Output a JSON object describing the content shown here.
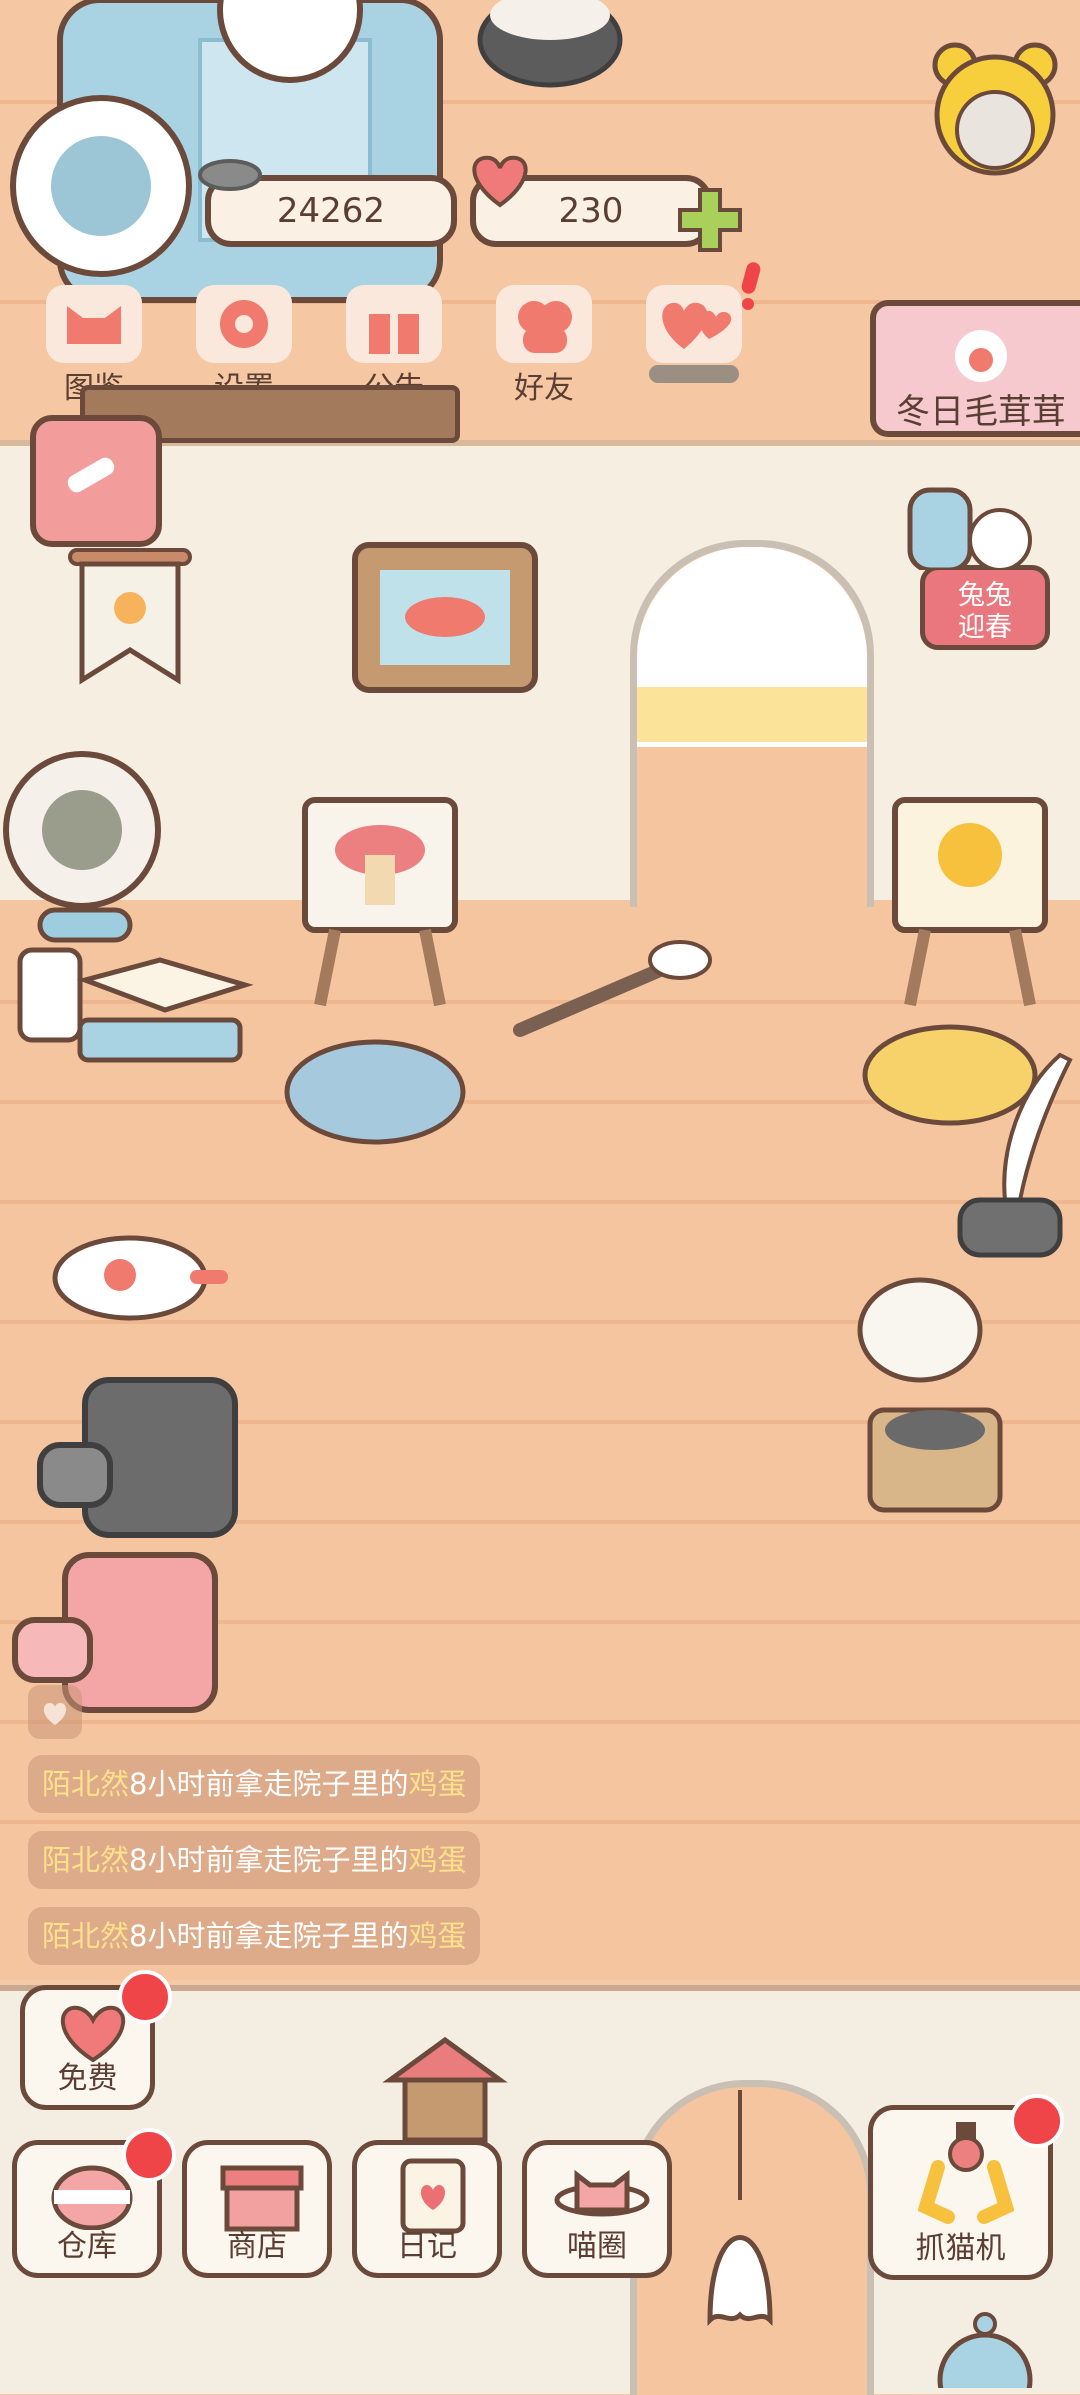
{
  "currency": {
    "fish": "24262",
    "hearts": "230"
  },
  "top_menu": [
    {
      "label": "图鉴",
      "icon": "cat-head-icon"
    },
    {
      "label": "设置",
      "icon": "gear-icon"
    },
    {
      "label": "公告",
      "icon": "gift-icon"
    },
    {
      "label": "好友",
      "icon": "friends-icon"
    },
    {
      "label": "",
      "icon": "hearts-icon"
    }
  ],
  "event_banner": "冬日毛茸茸",
  "spring_badge": [
    "兔兔",
    "迎春"
  ],
  "feed": [
    {
      "name": "陌北然",
      "text": "8小时前拿走院子里的",
      "item": "鸡蛋"
    },
    {
      "name": "陌北然",
      "text": "8小时前拿走院子里的",
      "item": "鸡蛋"
    },
    {
      "name": "陌北然",
      "text": "8小时前拿走院子里的",
      "item": "鸡蛋"
    }
  ],
  "bottom": {
    "free": "免费",
    "warehouse": "仓库",
    "shop": "商店",
    "diary": "日记",
    "circle": "喵圈",
    "claw": "抓猫机"
  },
  "colors": {
    "accent_red": "#f04548",
    "outline": "#6b4a3b",
    "floor": "#f5c5a0"
  }
}
